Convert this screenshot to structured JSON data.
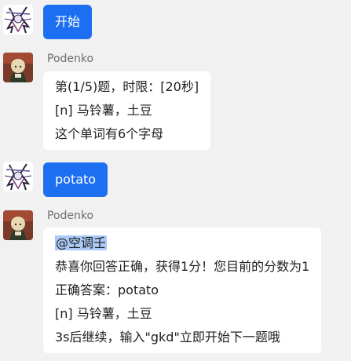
{
  "messages": [
    {
      "type": "user",
      "text": "开始"
    },
    {
      "type": "bot",
      "sender": "Podenko",
      "lines": [
        "第(1/5)题，时限：[20秒]",
        "[n] 马铃薯，土豆",
        "这个单词有6个字母"
      ]
    },
    {
      "type": "user",
      "text": "potato"
    },
    {
      "type": "bot",
      "sender": "Podenko",
      "mention": "@空调壬",
      "lines": [
        "恭喜你回答正确，获得1分！您目前的分数为1",
        "正确答案：potato",
        "[n] 马铃薯，土豆",
        "3s后继续，输入\"gkd\"立即开始下一题哦"
      ]
    }
  ],
  "colors": {
    "background": "#f1f1f1",
    "user_bubble": "#1d6ff2",
    "bot_bubble": "#ffffff",
    "mention_highlight": "#a9c9f6"
  },
  "icons": {
    "user_avatar": "anime-character-avatar",
    "bot_avatar": "podenko-avatar"
  }
}
